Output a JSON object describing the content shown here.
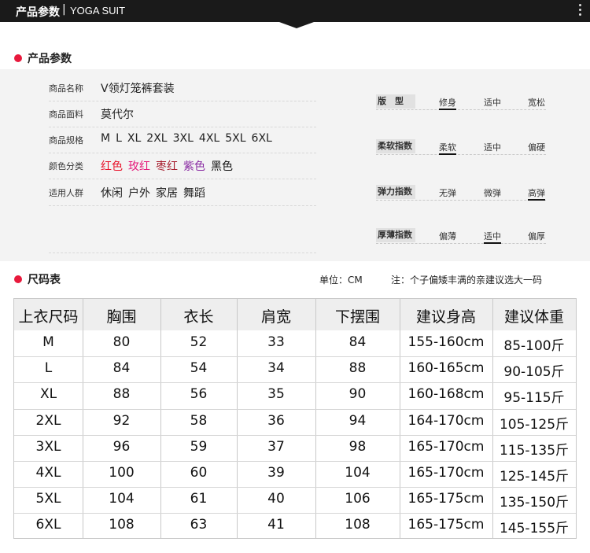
{
  "header": {
    "title": "产品参数",
    "sep": "|",
    "subtitle": "YOGA SUIT"
  },
  "params_section": {
    "title": "产品参数"
  },
  "params": [
    {
      "label": "商品名称",
      "values": [
        "V领灯笼裤套装"
      ],
      "colors": [
        "#222222"
      ]
    },
    {
      "label": "商品面料",
      "values": [
        "莫代尔"
      ],
      "colors": [
        "#222222"
      ]
    },
    {
      "label": "商品规格",
      "values": [
        "M",
        "L",
        "XL",
        "2XL",
        "3XL",
        "4XL",
        "5XL",
        "6XL"
      ],
      "colors": [
        "#222222",
        "#222222",
        "#222222",
        "#222222",
        "#222222",
        "#222222",
        "#222222",
        "#222222"
      ]
    },
    {
      "label": "颜色分类",
      "values": [
        "红色",
        "玫红",
        "枣红",
        "紫色",
        "黑色"
      ],
      "colors": [
        "#e8132a",
        "#e5187a",
        "#a61c2c",
        "#8a2ca3",
        "#111111"
      ]
    },
    {
      "label": "适用人群",
      "values": [
        "休闲",
        "户外",
        "家居",
        "舞蹈"
      ],
      "colors": [
        "#222222",
        "#222222",
        "#222222",
        "#222222"
      ]
    }
  ],
  "specs": [
    {
      "name": "版　型",
      "options": [
        "修身",
        "适中",
        "宽松"
      ],
      "selected": 0
    },
    {
      "name": "柔软指数",
      "options": [
        "柔软",
        "适中",
        "偏硬"
      ],
      "selected": 0
    },
    {
      "name": "弹力指数",
      "options": [
        "无弹",
        "微弹",
        "高弹"
      ],
      "selected": 2
    },
    {
      "name": "厚薄指数",
      "options": [
        "偏薄",
        "适中",
        "偏厚"
      ],
      "selected": 1
    }
  ],
  "size_section": {
    "title": "尺码表",
    "unit": "单位：CM",
    "note": "注：个子偏矮丰满的亲建议选大一码"
  },
  "size_table": {
    "headers": [
      "上衣尺码",
      "胸围",
      "衣长",
      "肩宽",
      "下摆围",
      "建议身高",
      "建议体重"
    ],
    "rows": [
      [
        "M",
        "80",
        "52",
        "33",
        "84",
        "155-160cm",
        "85-100斤"
      ],
      [
        "L",
        "84",
        "54",
        "34",
        "88",
        "160-165cm",
        "90-105斤"
      ],
      [
        "XL",
        "88",
        "56",
        "35",
        "90",
        "160-168cm",
        "95-115斤"
      ],
      [
        "2XL",
        "92",
        "58",
        "36",
        "94",
        "164-170cm",
        "105-125斤"
      ],
      [
        "3XL",
        "96",
        "59",
        "37",
        "98",
        "165-170cm",
        "115-135斤"
      ],
      [
        "4XL",
        "100",
        "60",
        "39",
        "104",
        "165-170cm",
        "125-145斤"
      ],
      [
        "5XL",
        "104",
        "61",
        "40",
        "106",
        "165-175cm",
        "135-150斤"
      ],
      [
        "6XL",
        "108",
        "63",
        "41",
        "108",
        "165-175cm",
        "145-155斤"
      ]
    ]
  }
}
